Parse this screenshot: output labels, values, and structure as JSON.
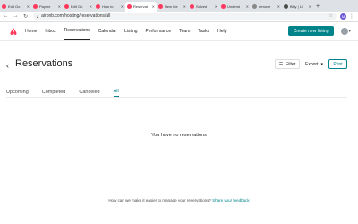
{
  "browser": {
    "tabs": [
      {
        "label": "Edit Go",
        "icon": "airbnb"
      },
      {
        "label": "Payme",
        "icon": "airbnb"
      },
      {
        "label": "Edit Go",
        "icon": "airbnb"
      },
      {
        "label": "How to",
        "icon": "airbnb"
      },
      {
        "label": "Reservat",
        "icon": "airbnb",
        "active": true
      },
      {
        "label": "New Me",
        "icon": "airbnb"
      },
      {
        "label": "Solved",
        "icon": "airbnb"
      },
      {
        "label": "Underst",
        "icon": "airbnb"
      },
      {
        "label": "remove",
        "icon": "solver"
      },
      {
        "label": "Bitly | Li",
        "icon": "bitly"
      }
    ],
    "new_tab": "+",
    "url": "airbnb.com/hosting/reservations/all",
    "profile_initial": "M",
    "colors": {
      "tabbar": "#dee1e6",
      "profile": "#6b5bd6"
    }
  },
  "site_nav": {
    "items": [
      "Home",
      "Inbox",
      "Reservations",
      "Calendar",
      "Listing",
      "Performance",
      "Team",
      "Tasks",
      "Help"
    ],
    "active": "Reservations",
    "create_button": "Create new listing",
    "colors": {
      "brand": "#ff385c",
      "accent": "#008489"
    }
  },
  "page": {
    "title": "Reservations",
    "filter_label": "Filter",
    "export_label": "Export",
    "print_label": "Print",
    "tabs": [
      "Upcoming",
      "Completed",
      "Canceled",
      "All"
    ],
    "active_tab": "All",
    "empty_message": "You have no reservations",
    "footer_question": "How can we make it easier to manage your reservations?",
    "footer_link": "Share your feedback"
  }
}
